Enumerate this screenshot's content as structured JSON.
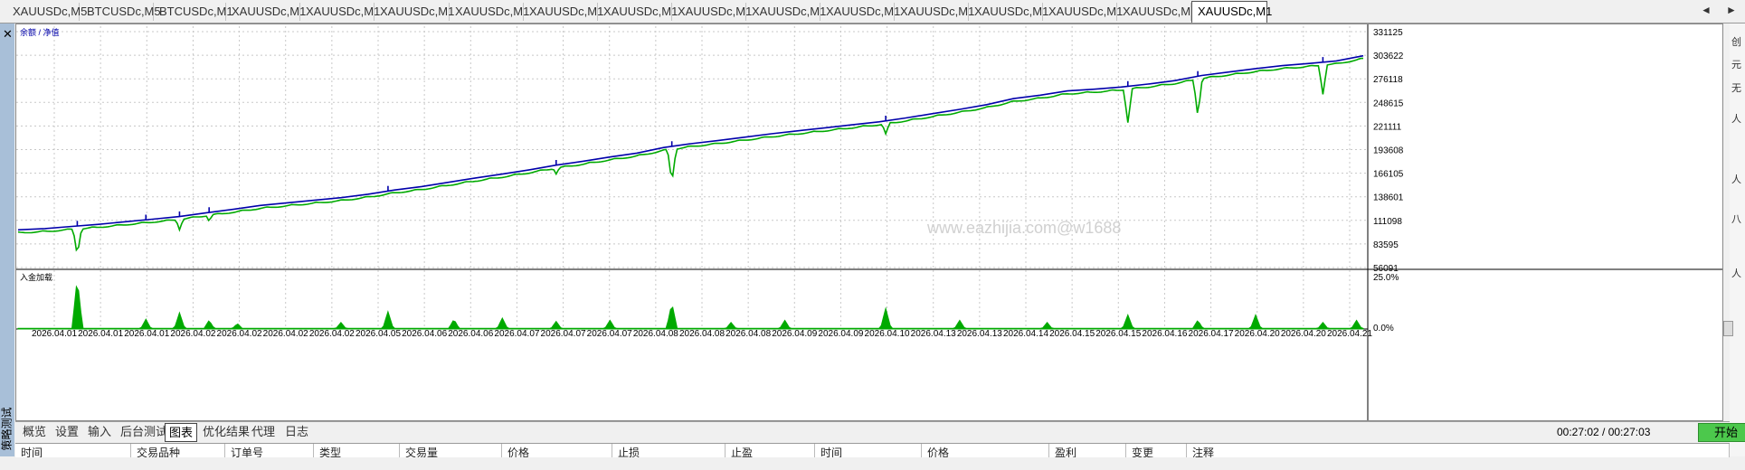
{
  "top_tabs": [
    "XAUUSDc,M5",
    "BTCUSDc,M5",
    "BTCUSDc,M1",
    "XAUUSDc,M1",
    "XAUUSDc,M1",
    "XAUUSDc,M1",
    "XAUUSDc,M1",
    "XAUUSDc,M1",
    "XAUUSDc,M1",
    "XAUUSDc,M1",
    "XAUUSDc,M1",
    "XAUUSDc,M1",
    "XAUUSDc,M1",
    "XAUUSDc,M1",
    "XAUUSDc,M1",
    "XAUUSDc,M1",
    "XAUUSDc,M1"
  ],
  "active_top_tab": 16,
  "nav": {
    "left": "◄",
    "right": "►"
  },
  "left_panel": {
    "close": "✕",
    "title": "策略测试"
  },
  "right_panel_marks": [
    "创",
    "元",
    "无",
    "人",
    "人",
    "八",
    "人"
  ],
  "watermark": "www.eazhijia.com@w1688",
  "chart_data": [
    {
      "type": "line",
      "legend": "余额 / 净值",
      "series": [
        {
          "name": "余额",
          "color": "#0000aa"
        },
        {
          "name": "净值",
          "color": "#00aa00"
        }
      ],
      "y_ticks": [
        "331125",
        "303622",
        "276118",
        "248615",
        "221111",
        "193608",
        "166105",
        "138601",
        "111098",
        "83595",
        "56091"
      ],
      "ylim": [
        56091,
        331125
      ],
      "x": [
        0,
        2,
        4,
        6,
        8,
        10,
        12,
        14,
        16,
        18,
        20,
        22,
        24,
        26,
        28,
        30,
        32,
        34,
        36,
        38,
        40,
        42,
        44,
        46,
        48,
        50,
        52,
        54,
        56,
        58,
        60,
        62,
        64,
        66,
        68,
        70,
        72,
        74,
        76,
        78,
        80,
        82,
        84,
        86,
        88,
        90,
        92,
        94,
        96,
        98,
        100
      ],
      "balance": [
        100000,
        101500,
        104000,
        106500,
        109500,
        112500,
        115500,
        120000,
        124000,
        128500,
        131500,
        134500,
        137500,
        141500,
        146500,
        150500,
        155500,
        160500,
        165000,
        170000,
        175500,
        180000,
        185000,
        189500,
        196000,
        200500,
        204000,
        208000,
        212000,
        215500,
        219000,
        222500,
        226000,
        230500,
        235500,
        240500,
        246000,
        253000,
        257000,
        262000,
        264000,
        266500,
        270000,
        274000,
        280000,
        284000,
        288000,
        291500,
        294000,
        297000,
        303000
      ],
      "equity_dips": [
        {
          "at": 4.4,
          "value": 70000
        },
        {
          "at": 9.5,
          "value": 117000
        },
        {
          "at": 12.0,
          "value": 100000
        },
        {
          "at": 14.2,
          "value": 110000
        },
        {
          "at": 27.5,
          "value": 143000
        },
        {
          "at": 40.0,
          "value": 165000
        },
        {
          "at": 48.6,
          "value": 155000
        },
        {
          "at": 64.5,
          "value": 212000
        },
        {
          "at": 82.5,
          "value": 225000
        },
        {
          "at": 87.7,
          "value": 232000
        },
        {
          "at": 97.0,
          "value": 258000
        }
      ],
      "x_ticks": [
        "2026.04.01",
        "2026.04.01",
        "2026.04.01",
        "2026.04.02",
        "2026.04.02",
        "2026.04.02",
        "2026.04.02",
        "2026.04.05",
        "2026.04.06",
        "2026.04.06",
        "2026.04.07",
        "2026.04.07",
        "2026.04.07",
        "2026.04.08",
        "2026.04.08",
        "2026.04.08",
        "2026.04.09",
        "2026.04.09",
        "2026.04.10",
        "2026.04.13",
        "2026.04.13",
        "2026.04.14",
        "2026.04.15",
        "2026.04.15",
        "2026.04.16",
        "2026.04.17",
        "2026.04.20",
        "2026.04.20",
        "2026.04.21"
      ]
    },
    {
      "type": "area",
      "legend": "入金加载",
      "color": "#00aa00",
      "y_ticks": [
        "25.0%",
        "0.0%"
      ],
      "ylim": [
        0,
        25
      ],
      "spikes": [
        {
          "at": 4.4,
          "value": 23.5
        },
        {
          "at": 9.5,
          "value": 4.5
        },
        {
          "at": 12.0,
          "value": 7.5
        },
        {
          "at": 14.2,
          "value": 4.0
        },
        {
          "at": 16.3,
          "value": 2.5
        },
        {
          "at": 24.0,
          "value": 3.0
        },
        {
          "at": 27.5,
          "value": 8.0
        },
        {
          "at": 32.4,
          "value": 4.5
        },
        {
          "at": 36.0,
          "value": 5.0
        },
        {
          "at": 40.0,
          "value": 3.5
        },
        {
          "at": 44.0,
          "value": 4.0
        },
        {
          "at": 48.6,
          "value": 12.0
        },
        {
          "at": 53.0,
          "value": 3.0
        },
        {
          "at": 57.0,
          "value": 4.0
        },
        {
          "at": 64.5,
          "value": 9.5
        },
        {
          "at": 70.0,
          "value": 4.0
        },
        {
          "at": 76.5,
          "value": 3.0
        },
        {
          "at": 82.5,
          "value": 6.5
        },
        {
          "at": 87.7,
          "value": 4.0
        },
        {
          "at": 92.0,
          "value": 6.5
        },
        {
          "at": 97.0,
          "value": 3.0
        },
        {
          "at": 99.5,
          "value": 4.0
        }
      ]
    }
  ],
  "bottom_tabs": [
    "概览",
    "设置",
    "输入",
    "后台测试",
    "图表",
    "优化结果",
    "代理",
    "日志"
  ],
  "active_bottom_tab": 4,
  "time_text": "00:27:02 / 00:27:03",
  "start_label": "开始",
  "header_cells": [
    "时间",
    "交易品种",
    "订单号",
    "类型",
    "交易量",
    "价格",
    "止损",
    "止盈",
    "时间",
    "价格",
    "盈利",
    "变更",
    "注释"
  ]
}
